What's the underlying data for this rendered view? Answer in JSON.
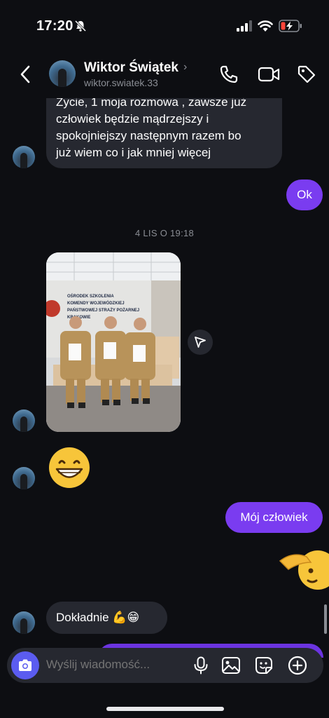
{
  "status_bar": {
    "time": "17:20"
  },
  "header": {
    "contact_name": "Wiktor Świątek",
    "chevron": "›",
    "username": "wiktor.swiatek.33",
    "icons": [
      "back-icon",
      "phone-icon",
      "video-icon",
      "tag-icon"
    ]
  },
  "messages": {
    "incoming_long_lines": [
      "Zycie,  1 moja rozmowa , zawsze już",
      "człowiek będzie mądrzejszy i",
      "spokojniejszy następnym razem bo",
      "już wiem co i jak mniej więcej"
    ],
    "outgoing_ok": "Ok",
    "timestamp": "4 LIS O 19:18",
    "photo_sign_lines": [
      "OŚRODEK SZKOLENIA",
      "KOMENDY WOJEWÓDZKIEJ",
      "PAŃSTWOWEJ STRAŻY POŻARNEJ",
      "KRAKOWIE"
    ],
    "emoji_reaction": "grinning-face-emoji",
    "outgoing_moj": "Mój człowiek",
    "outgoing_emoji": "saluting-face-emoji",
    "incoming_dokladnie": "Dokładnie 💪😁"
  },
  "composer": {
    "placeholder": "Wyślij wiadomość..."
  },
  "colors": {
    "background": "#0d0e12",
    "incoming_bubble": "#262830",
    "outgoing_bubble": "#7a3cf0",
    "camera_button": "#5b5cf0"
  }
}
